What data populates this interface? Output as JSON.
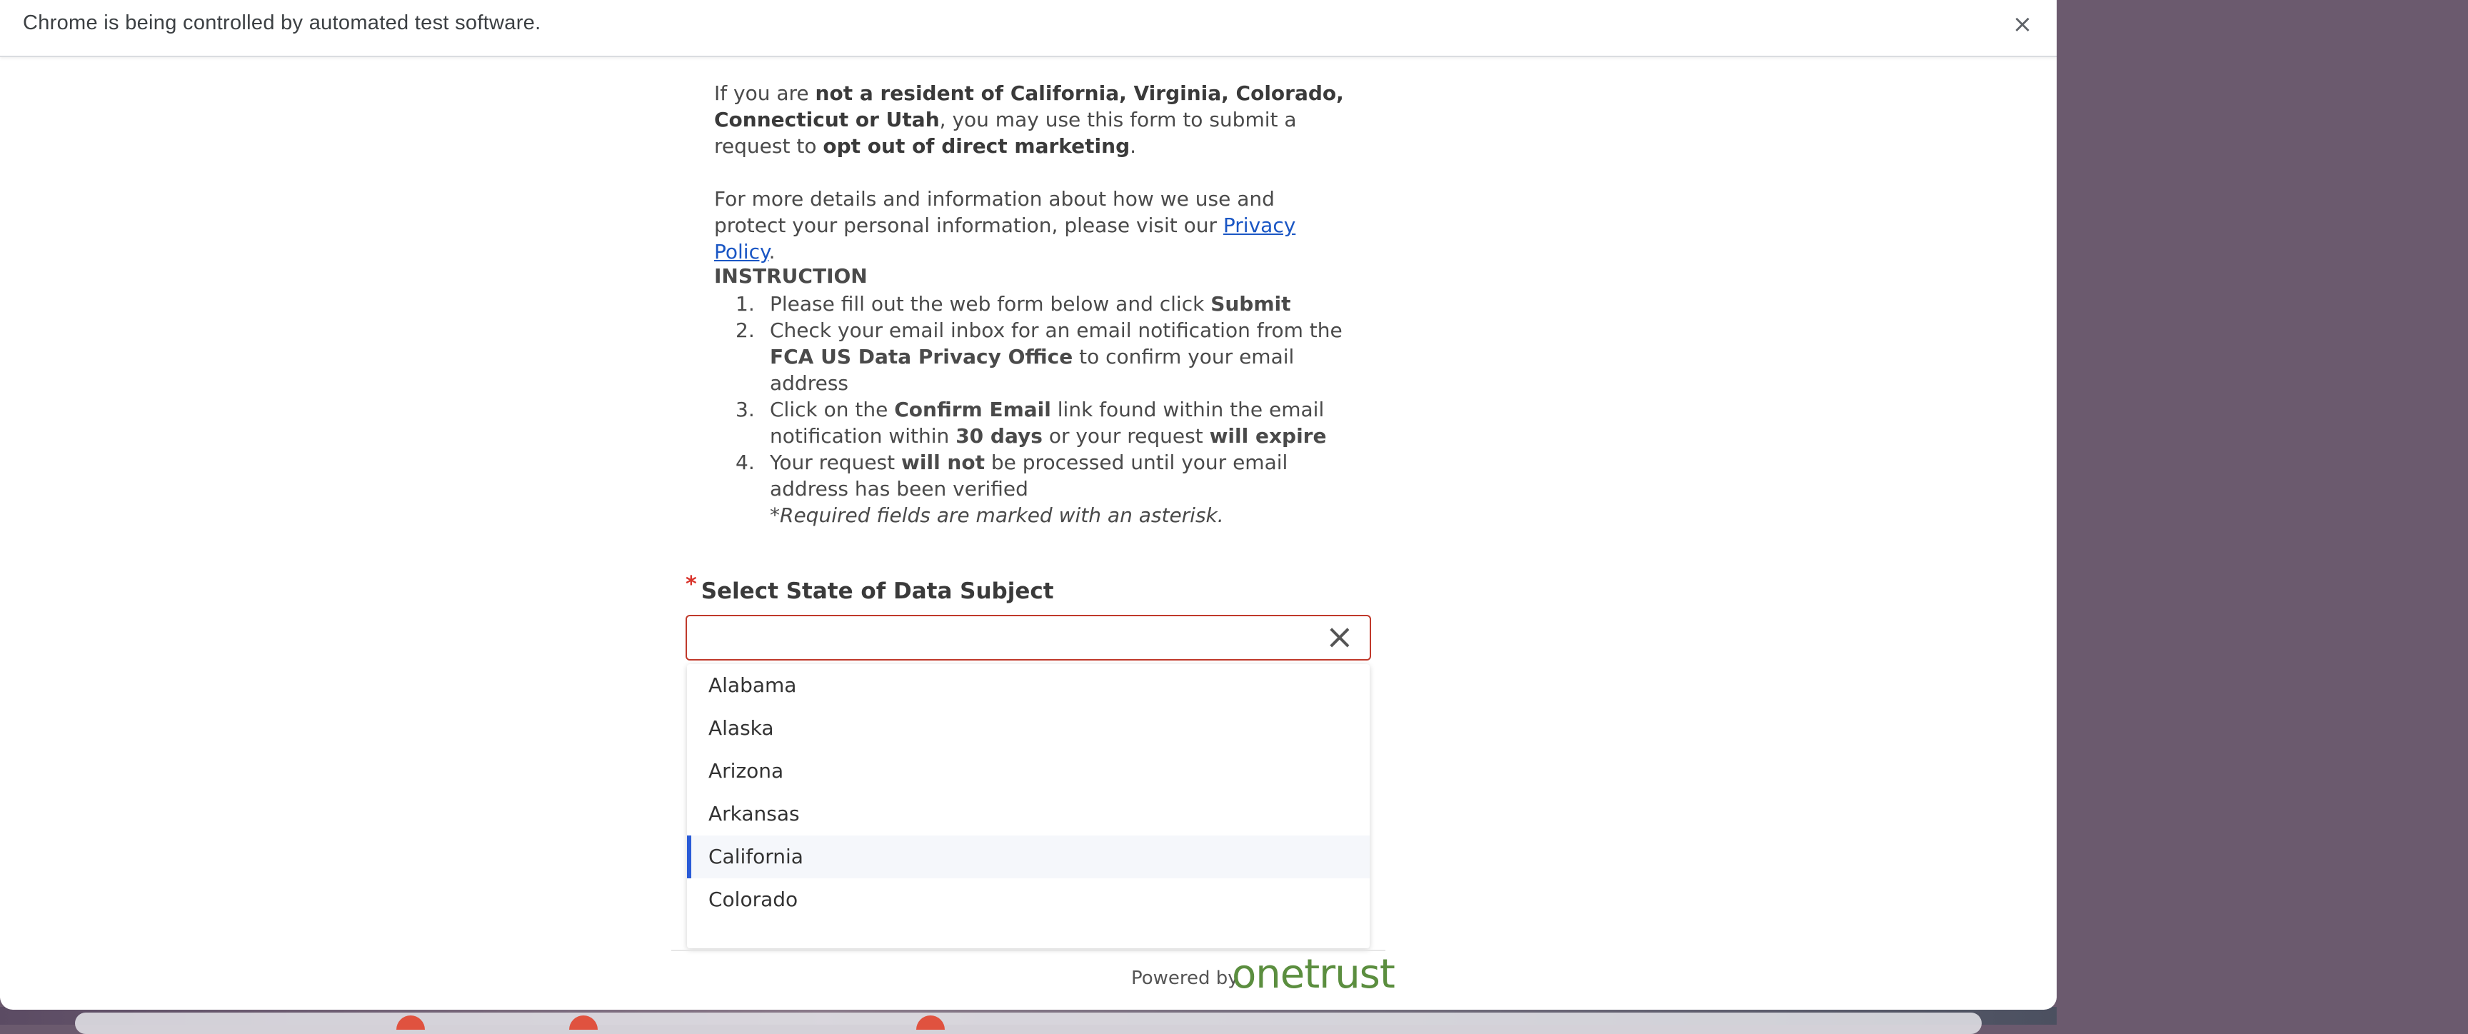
{
  "infobar": {
    "message": "Chrome is being controlled by automated test software.",
    "close_symbol": "×"
  },
  "intro": {
    "p1_a": "If you are ",
    "p1_b": "not a resident of California, Virginia, Colorado, Connecticut or Utah",
    "p1_c": ", you may use this form to submit a request to ",
    "p1_d": "opt out of direct marketing",
    "p1_e": ".",
    "p2_a": "For more details and information about how we use and protect your personal information, please visit our ",
    "p2_link": "Privacy Policy",
    "p2_b": "."
  },
  "instruction": {
    "heading": "INSTRUCTION",
    "s1_num": "1.",
    "s1_a": "Please fill out the web form below and click ",
    "s1_b": "Submit",
    "s2_num": "2.",
    "s2_a": "Check your email inbox for an email notification from the ",
    "s2_b": "FCA US Data Privacy Office",
    "s2_c": " to confirm your email address",
    "s3_num": "3.",
    "s3_a": "Click on the ",
    "s3_b": "Confirm Email",
    "s3_c": " link found within the email notification within ",
    "s3_d": "30 days",
    "s3_e": " or your request ",
    "s3_f": "will expire",
    "s4_num": "4.",
    "s4_a": "Your request ",
    "s4_b": "will not",
    "s4_c": " be processed until your email address has been verified",
    "required_note": "*Required fields are marked with an asterisk."
  },
  "state_field": {
    "asterisk": "*",
    "label": "Select State of Data Subject",
    "value": "",
    "clear_symbol": "×",
    "options": [
      "Alabama",
      "Alaska",
      "Arizona",
      "Arkansas",
      "California",
      "Colorado"
    ],
    "highlighted": "California"
  },
  "footer": {
    "powered_by": "Powered by",
    "brand": "onetrust",
    "brand_color": "#5b8e3f"
  },
  "colors": {
    "accent": "#2a5bd7",
    "error_border": "#c0392b",
    "link": "#1a56c4"
  }
}
